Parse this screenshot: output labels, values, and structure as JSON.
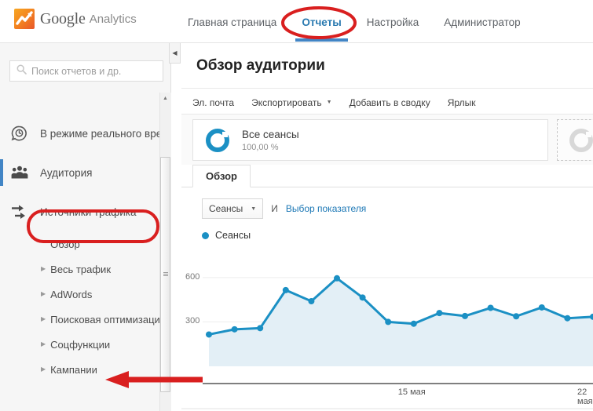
{
  "brand": {
    "word": "Google",
    "sub": "Analytics",
    "logo_icon": "analytics-logo-icon",
    "logo_color": "#e8562a"
  },
  "topnav": {
    "items": [
      {
        "label": "Главная страница",
        "active": false
      },
      {
        "label": "Отчеты",
        "active": true
      },
      {
        "label": "Настройка",
        "active": false
      },
      {
        "label": "Администратор",
        "active": false
      }
    ],
    "active_color": "#2a7ab0"
  },
  "search": {
    "placeholder": "Поиск отчетов и др.",
    "value": "",
    "icon": "search-icon"
  },
  "sidebar": {
    "collapse_icon": "chevron-left-icon",
    "scroll_up_icon": "triangle-up-icon",
    "items": [
      {
        "label": "В режиме реального времени",
        "icon": "realtime-clock-icon"
      },
      {
        "label": "Аудитория",
        "icon": "people-group-icon"
      },
      {
        "label": "Источники трафика",
        "icon": "acquisition-arrows-icon"
      }
    ],
    "subitems": [
      {
        "label": "Обзор",
        "has_caret": false
      },
      {
        "label": "Весь трафик",
        "has_caret": true
      },
      {
        "label": "AdWords",
        "has_caret": true
      },
      {
        "label": "Поисковая оптимизация",
        "has_caret": true
      },
      {
        "label": "Соцфункции",
        "has_caret": true
      },
      {
        "label": "Кампании",
        "has_caret": true
      }
    ]
  },
  "main": {
    "page_title": "Обзор аудитории",
    "toolbar": [
      {
        "label": "Эл. почта",
        "dropdown": false
      },
      {
        "label": "Экспортировать",
        "dropdown": true
      },
      {
        "label": "Добавить в сводку",
        "dropdown": false
      },
      {
        "label": "Ярлык",
        "dropdown": false
      }
    ],
    "segment": {
      "name": "Все сеансы",
      "percent": "100,00 %",
      "icon": "segment-donut-icon",
      "add_icon": "add-segment-donut-icon"
    },
    "tabs": [
      {
        "label": "Обзор",
        "active": true
      }
    ],
    "metric": {
      "selected": "Сеансы",
      "conjunction": "И",
      "link_label": "Выбор показателя",
      "dropdown_icon": "chevron-down-icon",
      "link_color": "#1b77b5"
    },
    "legend": [
      {
        "label": "Сеансы",
        "color": "#1b90c4"
      }
    ]
  },
  "chart_data": {
    "type": "line",
    "title": "Сеансы",
    "xlabel": "",
    "ylabel": "",
    "ylim": [
      0,
      700
    ],
    "yticks": [
      300,
      600
    ],
    "ytick_labels": [
      "300",
      "600"
    ],
    "xtick_labels": [
      "15 мая",
      "22 мая"
    ],
    "xtick_indices": [
      8,
      15
    ],
    "grid": true,
    "legend_position": "top-left",
    "series": [
      {
        "name": "Сеансы",
        "color": "#1b90c4",
        "fill_color": "#e3eff6",
        "values": [
          215,
          250,
          258,
          515,
          440,
          595,
          465,
          300,
          288,
          360,
          340,
          395,
          338,
          398,
          325,
          335
        ]
      }
    ]
  },
  "annotations": [
    {
      "type": "ellipse",
      "target": "Отчеты",
      "color": "#d91f1f"
    },
    {
      "type": "rounded-rect",
      "target": "Источники трафика",
      "color": "#d91f1f"
    },
    {
      "type": "arrow",
      "target": "Кампании",
      "color": "#d91f1f"
    }
  ]
}
